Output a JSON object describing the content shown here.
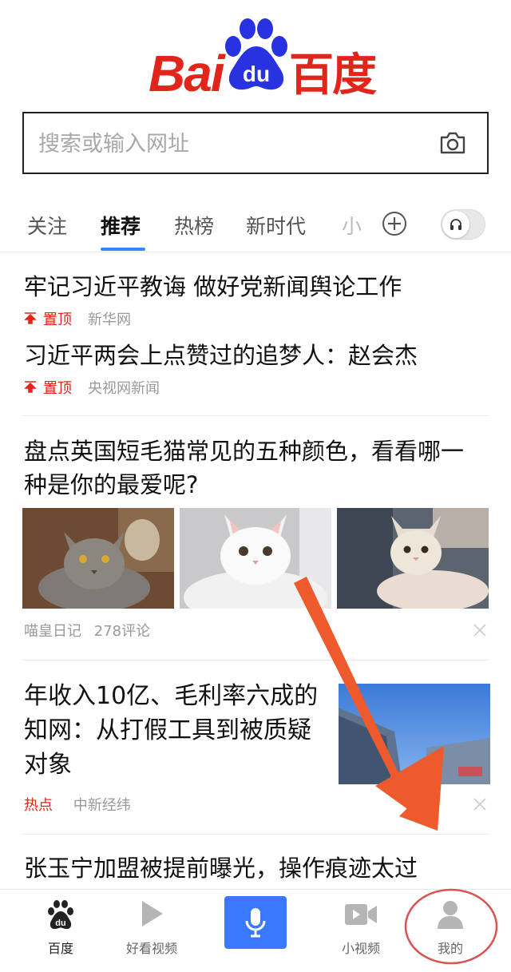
{
  "logo": {
    "text_en": "Bai",
    "text_du": "du",
    "text_cn": "百度"
  },
  "search": {
    "placeholder": "搜索或输入网址"
  },
  "tabs": [
    {
      "label": "关注",
      "active": false
    },
    {
      "label": "推荐",
      "active": true
    },
    {
      "label": "热榜",
      "active": false
    },
    {
      "label": "新时代",
      "active": false
    }
  ],
  "tabs_truncated": "小",
  "feed": {
    "item1": {
      "title": "牢记习近平教诲 做好党新闻舆论工作",
      "pin": "置顶",
      "source": "新华网"
    },
    "item2": {
      "title": "习近平两会上点赞过的追梦人：赵会杰",
      "pin": "置顶",
      "source": "央视网新闻"
    },
    "item3": {
      "title": "盘点英国短毛猫常见的五种颜色，看看哪一种是你的最爱呢?",
      "source": "喵皇日记",
      "comments": "278评论"
    },
    "item4": {
      "title": "年收入10亿、毛利率六成的知网：从打假工具到被质疑对象",
      "tag": "热点",
      "source": "中新经纬"
    },
    "item5": {
      "title": "张玉宁加盟被提前曝光，操作痕迹太过"
    }
  },
  "bottom_nav": [
    {
      "label": "百度",
      "icon": "baidu-paw-icon",
      "active": true
    },
    {
      "label": "好看视频",
      "icon": "play-icon",
      "active": false
    },
    {
      "label": "",
      "icon": "microphone-icon",
      "active": false
    },
    {
      "label": "小视频",
      "icon": "video-camera-icon",
      "active": false
    },
    {
      "label": "我的",
      "icon": "user-icon",
      "active": false
    }
  ],
  "colors": {
    "brand_red": "#e1251b",
    "brand_blue": "#2932e1",
    "accent_blue": "#3a79ff",
    "annotation_orange": "#ee5a2c"
  }
}
